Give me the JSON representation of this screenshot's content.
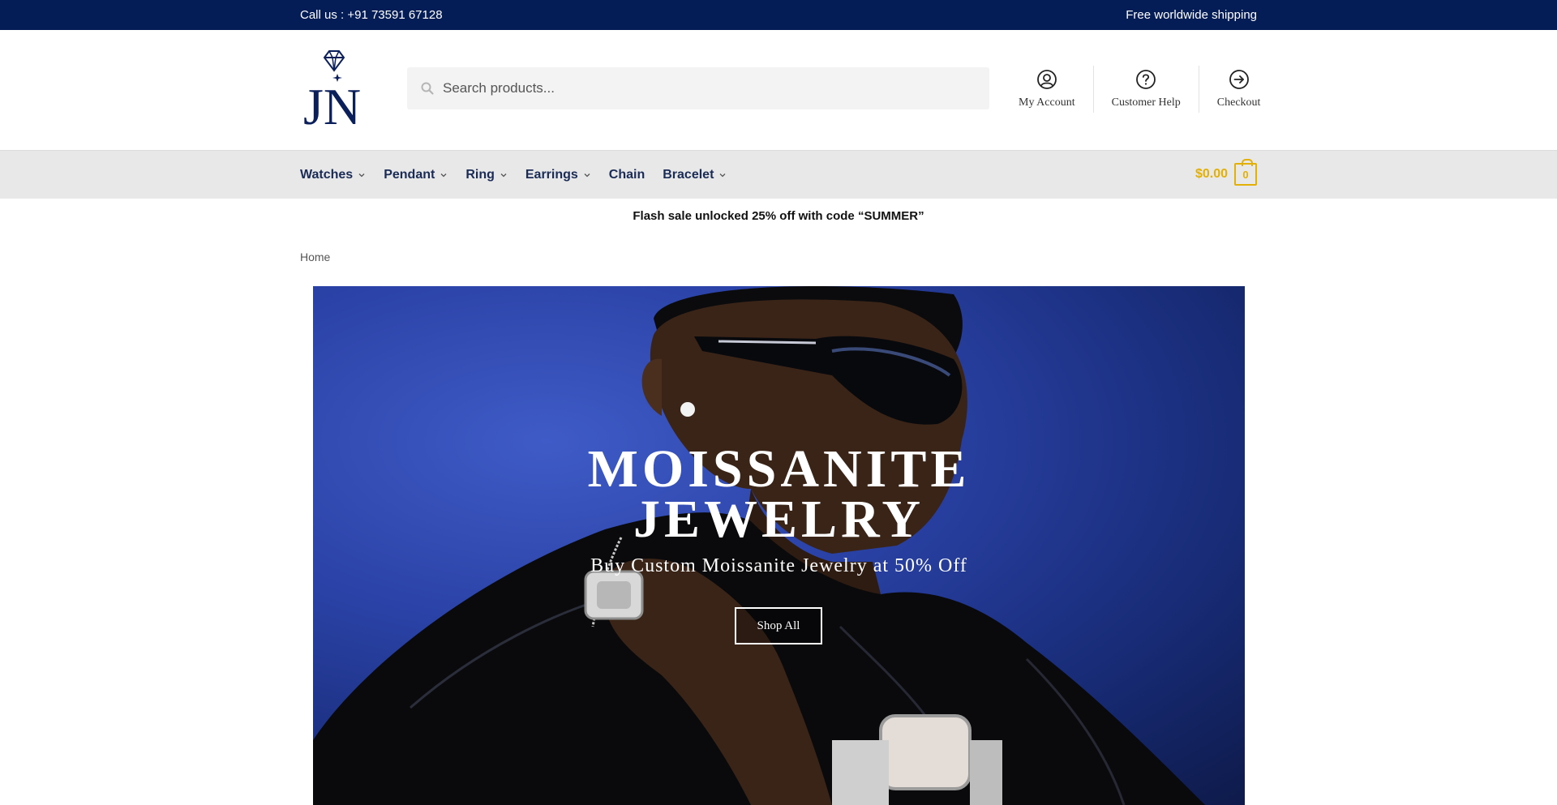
{
  "topbar": {
    "phone": "Call us : +91 73591 67128",
    "shipping": "Free worldwide shipping"
  },
  "header": {
    "logo_text": "JN",
    "search_placeholder": "Search products...",
    "links": [
      {
        "label": "My Account",
        "icon": "user-circle-icon"
      },
      {
        "label": "Customer Help",
        "icon": "help-circle-icon"
      },
      {
        "label": "Checkout",
        "icon": "arrow-right-circle-icon"
      }
    ]
  },
  "nav": {
    "items": [
      {
        "label": "Watches",
        "has_dropdown": true
      },
      {
        "label": "Pendant",
        "has_dropdown": true
      },
      {
        "label": "Ring",
        "has_dropdown": true
      },
      {
        "label": "Earrings",
        "has_dropdown": true
      },
      {
        "label": "Chain",
        "has_dropdown": false
      },
      {
        "label": "Bracelet",
        "has_dropdown": true
      }
    ],
    "cart_amount": "$0.00",
    "cart_count": "0"
  },
  "flash_sale": "Flash sale unlocked  25% off with code “SUMMER”",
  "breadcrumb": "Home",
  "hero": {
    "title_line1": "MOISSANITE",
    "title_line2": "JEWELRY",
    "subtitle": "Buy Custom Moissanite Jewelry at 50% Off",
    "button": "Shop All"
  },
  "colors": {
    "topbar_bg": "#041d57",
    "nav_text": "#1a2b55",
    "cart_accent": "#e2b007",
    "hero_bg": "#2b43a8"
  }
}
